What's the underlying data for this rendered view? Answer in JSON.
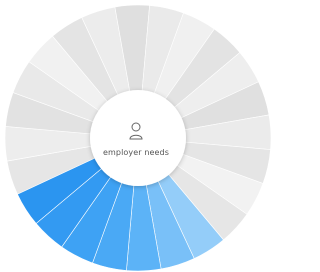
{
  "center": {
    "label": "employer needs",
    "icon": "user-icon"
  },
  "colors": {
    "inactive": [
      "#e6e6e6",
      "#ededed",
      "#e2e2e2",
      "#e9e9e9",
      "#f1f1f1",
      "#e4e4e4",
      "#ececec",
      "#dfdfdf",
      "#eaeaea",
      "#f0f0f0",
      "#e3e3e3",
      "#eeeeee",
      "#e0e0e0",
      "#ebebeb",
      "#e5e5e5",
      "#f2f2f2"
    ],
    "active": [
      "#2b95f0",
      "#339af2",
      "#3ea2f4",
      "#4aa9f5",
      "#5cb3f7",
      "#79c0f8",
      "#94cdf9"
    ],
    "background": "#ffffff",
    "hub": "#ffffff"
  },
  "segments": {
    "count": 24,
    "active_count": 7
  }
}
